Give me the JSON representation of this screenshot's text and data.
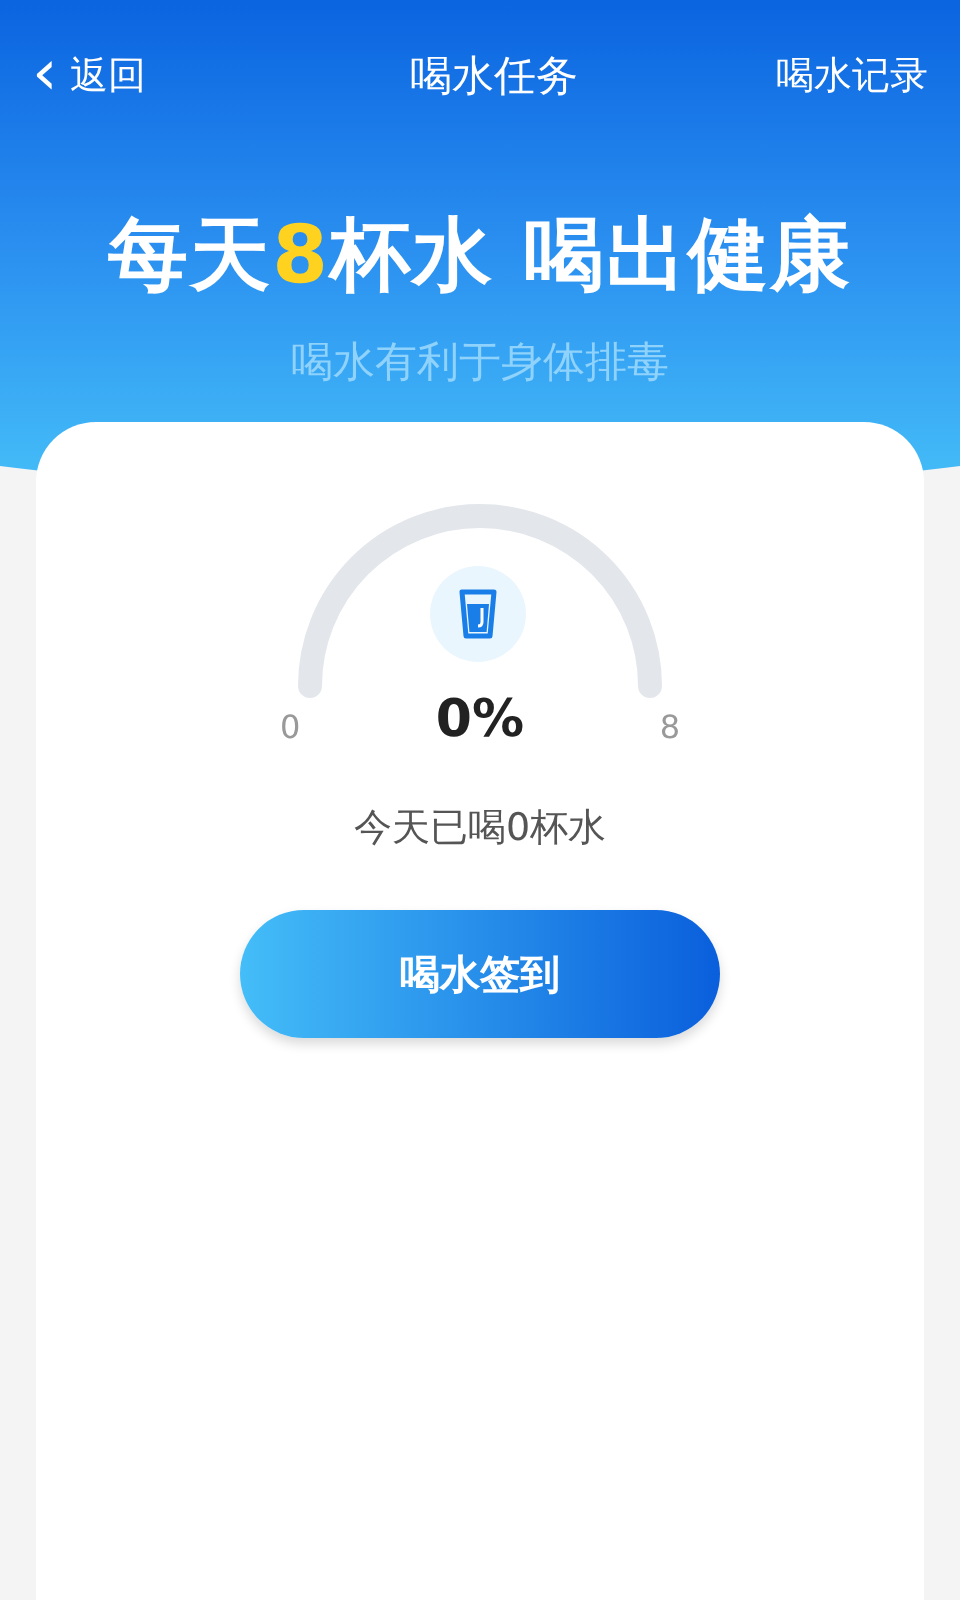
{
  "nav": {
    "back_icon": "‹",
    "back": "返回",
    "title": "喝水任务",
    "action": "喝水记录"
  },
  "headline": [
    {
      "text": "每天",
      "highlight": false
    },
    {
      "text": "8",
      "highlight": true
    },
    {
      "text": "杯水 喝出健康",
      "highlight": false
    }
  ],
  "subtitle": "喝水有利于身体排毒",
  "gauge": {
    "min": "0",
    "max": "8",
    "percent": "0%"
  },
  "status": "今天已喝0杯水",
  "button": "喝水签到"
}
